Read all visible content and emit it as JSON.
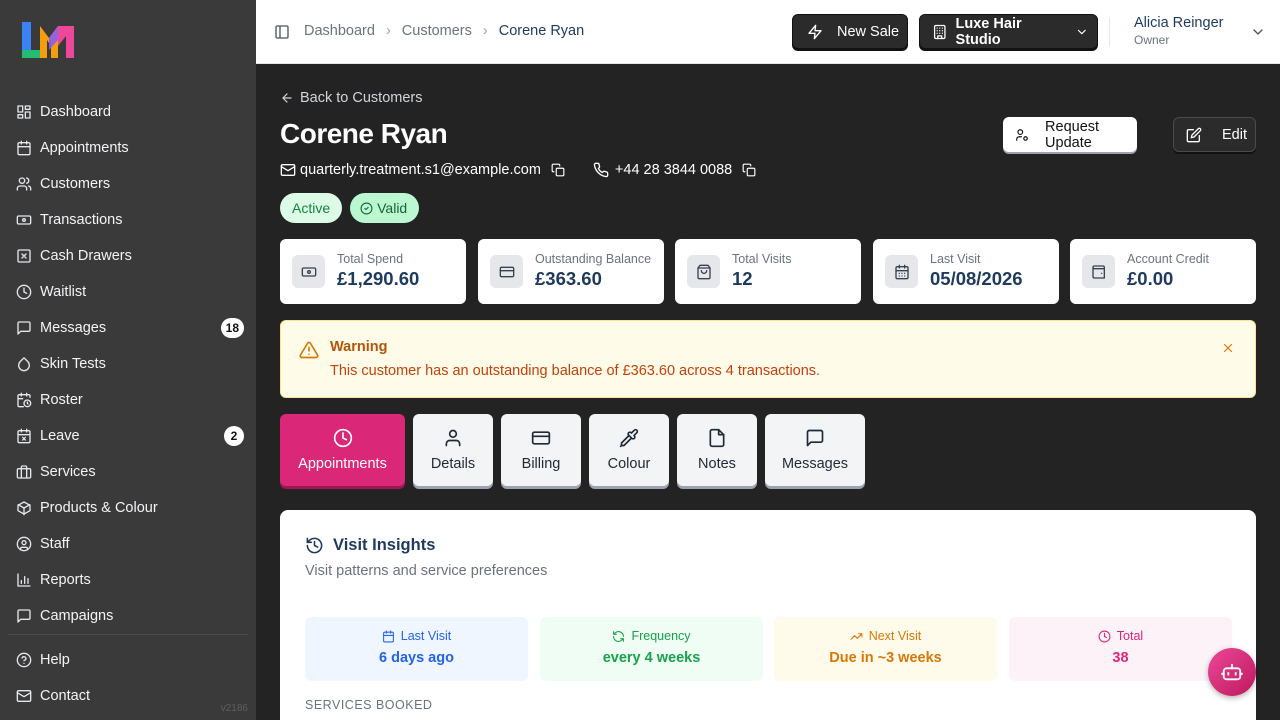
{
  "sidebar": {
    "items": [
      {
        "label": "Dashboard"
      },
      {
        "label": "Appointments"
      },
      {
        "label": "Customers"
      },
      {
        "label": "Transactions"
      },
      {
        "label": "Cash Drawers"
      },
      {
        "label": "Waitlist"
      },
      {
        "label": "Messages",
        "badge": "18"
      },
      {
        "label": "Skin Tests"
      },
      {
        "label": "Roster"
      },
      {
        "label": "Leave",
        "badge": "2"
      },
      {
        "label": "Services"
      },
      {
        "label": "Products & Colour"
      },
      {
        "label": "Staff"
      },
      {
        "label": "Reports"
      },
      {
        "label": "Campaigns"
      }
    ],
    "footer": [
      {
        "label": "Help"
      },
      {
        "label": "Contact"
      }
    ],
    "version": "v2186"
  },
  "header": {
    "breadcrumb": [
      "Dashboard",
      "Customers",
      "Corene Ryan"
    ],
    "new_sale_label": "New Sale",
    "studio_label": "Luxe Hair Studio",
    "user_name": "Alicia Reinger",
    "user_role": "Owner"
  },
  "customer": {
    "back_label": "Back to Customers",
    "name": "Corene Ryan",
    "email": "quarterly.treatment.s1@example.com",
    "phone": "+44 28 3844 0088",
    "status_badge": "Active",
    "validity_badge": "Valid",
    "request_update_label": "Request Update",
    "edit_label": "Edit"
  },
  "stats": [
    {
      "label": "Total Spend",
      "value": "£1,290.60",
      "icon": "banknote-icon"
    },
    {
      "label": "Outstanding Balance",
      "value": "£363.60",
      "icon": "credit-card-icon"
    },
    {
      "label": "Total Visits",
      "value": "12",
      "icon": "shopping-bag-icon"
    },
    {
      "label": "Last Visit",
      "value": "05/08/2026",
      "icon": "calendar-icon"
    },
    {
      "label": "Account Credit",
      "value": "£0.00",
      "icon": "wallet-icon"
    }
  ],
  "warning": {
    "title": "Warning",
    "message": "This customer has an outstanding balance of £363.60 across 4 transactions."
  },
  "tabs": [
    {
      "label": "Appointments",
      "active": true
    },
    {
      "label": "Details"
    },
    {
      "label": "Billing"
    },
    {
      "label": "Colour"
    },
    {
      "label": "Notes"
    },
    {
      "label": "Messages"
    }
  ],
  "insights": {
    "title": "Visit Insights",
    "subtitle": "Visit patterns and service preferences",
    "cards": [
      {
        "label": "Last Visit",
        "value": "6 days ago",
        "color": "#2563eb",
        "bg": "#eff6ff"
      },
      {
        "label": "Frequency",
        "value": "every 4 weeks",
        "color": "#16a34a",
        "bg": "#f0fdf4"
      },
      {
        "label": "Next Visit",
        "value": "Due in ~3 weeks",
        "color": "#d97706",
        "bg": "#fffbeb"
      },
      {
        "label": "Total",
        "value": "38",
        "color": "#db2777",
        "bg": "#fdf2f8"
      }
    ],
    "services_heading": "SERVICES BOOKED"
  },
  "colors": {
    "accent": "#db2777",
    "navy": "#1e3a5f",
    "sidebar_bg": "#3a3a3a",
    "main_bg": "#232323"
  }
}
